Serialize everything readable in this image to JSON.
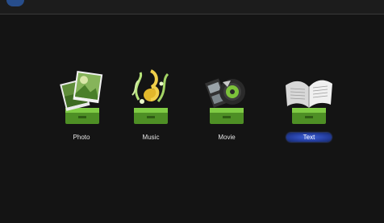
{
  "menu": {
    "items": [
      {
        "label": "Photo",
        "icon": "photo-icon",
        "selected": false
      },
      {
        "label": "Music",
        "icon": "music-icon",
        "selected": false
      },
      {
        "label": "Movie",
        "icon": "movie-icon",
        "selected": false
      },
      {
        "label": "Text",
        "icon": "text-book-icon",
        "selected": true
      }
    ]
  },
  "colors": {
    "background": "#141414",
    "stand_green": "#6dbb3a",
    "selected_blue": "#2c48b8"
  }
}
